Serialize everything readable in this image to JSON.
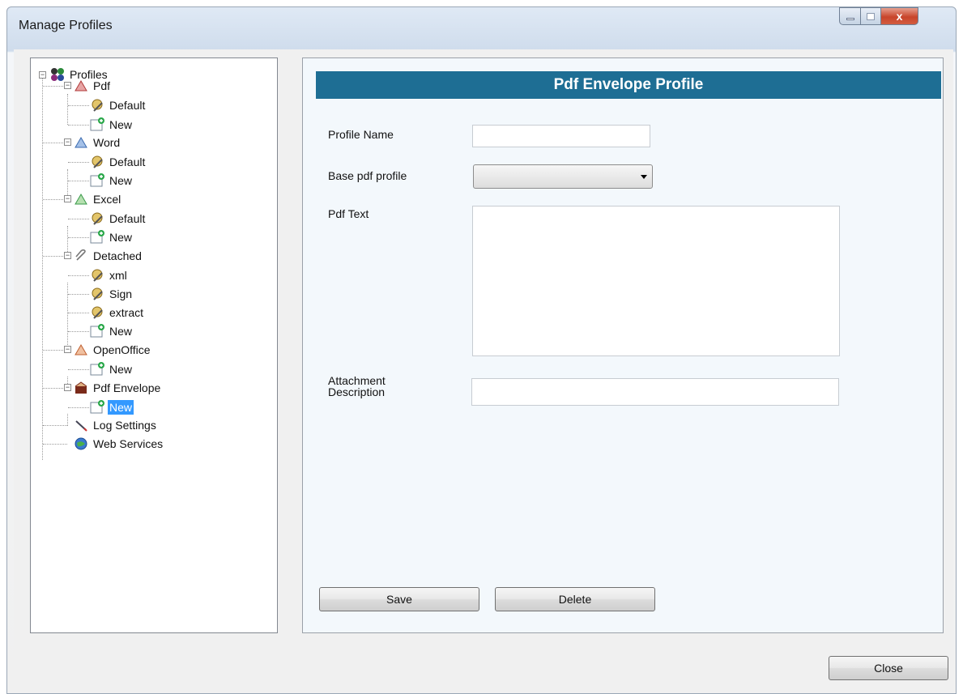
{
  "window": {
    "title": "Manage Profiles",
    "close_glyph": "x"
  },
  "tree": {
    "root": "Profiles",
    "groups": [
      {
        "label": "Pdf",
        "children": [
          "Default",
          "New"
        ]
      },
      {
        "label": "Word",
        "children": [
          "Default",
          "New"
        ]
      },
      {
        "label": "Excel",
        "children": [
          "Default",
          "New"
        ]
      },
      {
        "label": "Detached",
        "children": [
          "xml",
          "Sign",
          "extract",
          "New"
        ]
      },
      {
        "label": "OpenOffice",
        "children": [
          "New"
        ]
      },
      {
        "label": "Pdf Envelope",
        "children": [
          "New"
        ]
      }
    ],
    "leaves": [
      "Log Settings",
      "Web Services"
    ],
    "selected": "Pdf Envelope / New"
  },
  "form": {
    "header": "Pdf Envelope Profile",
    "profile_name_label": "Profile Name",
    "profile_name_value": "",
    "base_pdf_label": "Base pdf profile",
    "base_pdf_value": "",
    "pdf_text_label": "Pdf Text",
    "pdf_text_value": "",
    "attachment_label_line1": "Attachment",
    "attachment_label_line2": "Description",
    "attachment_value": "",
    "save_label": "Save",
    "delete_label": "Delete"
  },
  "footer": {
    "close_label": "Close"
  },
  "colors": {
    "header_bg": "#1e6e94",
    "selection": "#3399ff"
  }
}
